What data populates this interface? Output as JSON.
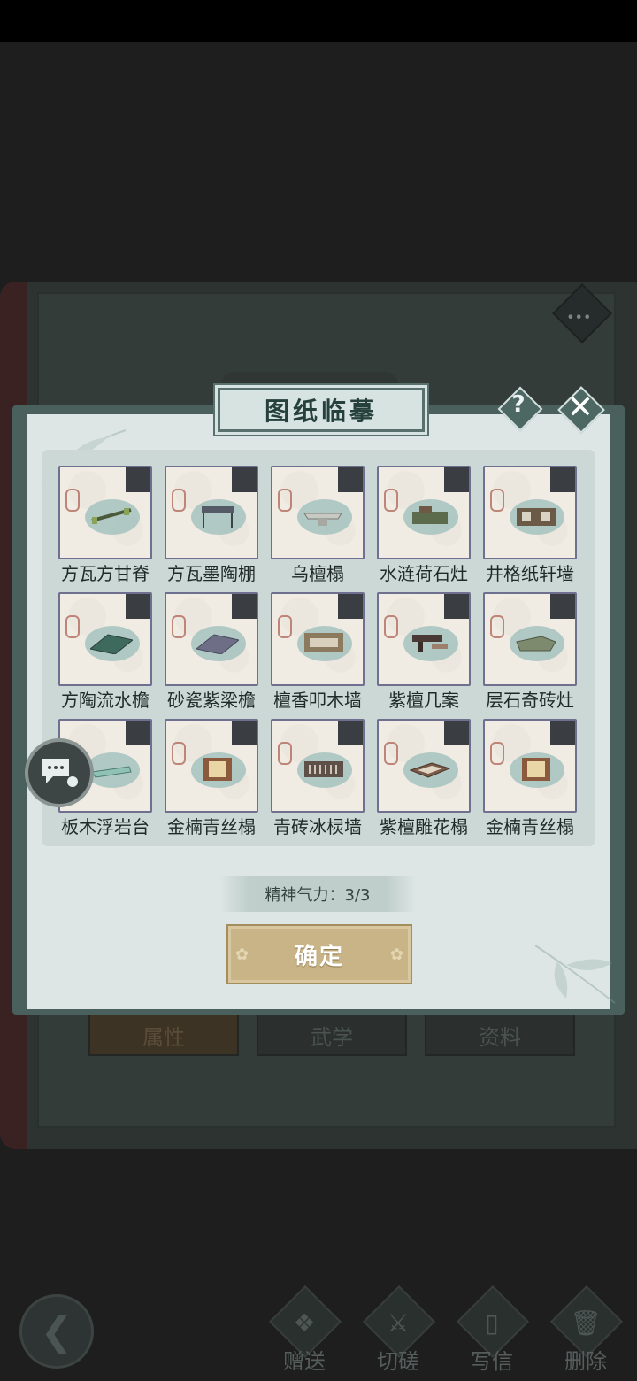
{
  "dialog": {
    "title": "图纸临摹",
    "help_icon": "question-icon",
    "close_icon": "close-icon",
    "items": [
      {
        "name": "方瓦方甘脊"
      },
      {
        "name": "方瓦墨陶棚"
      },
      {
        "name": "乌檀榻"
      },
      {
        "name": "水涟荷石灶"
      },
      {
        "name": "井格纸轩墙"
      },
      {
        "name": "方陶流水檐"
      },
      {
        "name": "砂瓷紫梁檐"
      },
      {
        "name": "檀香叩木墙"
      },
      {
        "name": "紫檀几案"
      },
      {
        "name": "层石奇砖灶"
      },
      {
        "name": "板木浮岩台"
      },
      {
        "name": "金楠青丝榻"
      },
      {
        "name": "青砖冰棂墙"
      },
      {
        "name": "紫檀雕花榻"
      },
      {
        "name": "金楠青丝榻"
      }
    ],
    "stamina_label": "精神气力：3/3",
    "confirm_label": "确定"
  },
  "background": {
    "tabs": [
      "属性",
      "武学",
      "资料"
    ]
  },
  "bottom_nav": {
    "back_icon": "back-arrow-icon",
    "items": [
      {
        "label": "赠送",
        "icon": "scroll-icon"
      },
      {
        "label": "切磋",
        "icon": "sword-icon"
      },
      {
        "label": "写信",
        "icon": "letter-icon"
      },
      {
        "label": "删除",
        "icon": "trash-icon"
      }
    ]
  },
  "colors": {
    "dialog_body": "#dde6e4",
    "frame": "#49605c",
    "confirm_button": "#c9b487",
    "card_border": "#6f6f8f"
  }
}
